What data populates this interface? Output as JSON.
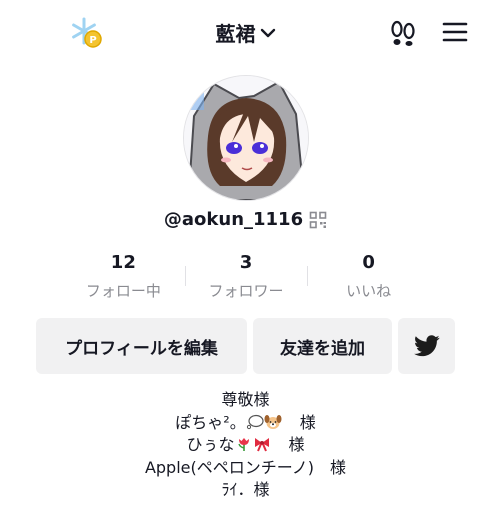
{
  "header": {
    "username_title": "藍裙",
    "icons": [
      "snowflake-coin-icon",
      "chevron-down-icon",
      "footsteps-icon",
      "menu-icon"
    ]
  },
  "profile": {
    "handle": "@aokun_1116",
    "stats": [
      {
        "value": "12",
        "label": "フォロー中"
      },
      {
        "value": "3",
        "label": "フォロワー"
      },
      {
        "value": "0",
        "label": "いいね"
      }
    ]
  },
  "actions": {
    "edit_profile": "プロフィールを編集",
    "add_friends": "友達を追加"
  },
  "bio": {
    "line1": "尊敬様",
    "line2_text": "ぽちゃ²。",
    "line2_suffix": "様",
    "line3_text": "ひぅな",
    "line3_suffix": "様",
    "line4": "Apple(ペペロンチーノ)　様",
    "line5": "ﾗｲ．様"
  },
  "colors": {
    "text": "#161823",
    "muted": "#8a8b91",
    "button_bg": "#f1f1f2",
    "twitter": "#1c1c1c"
  }
}
